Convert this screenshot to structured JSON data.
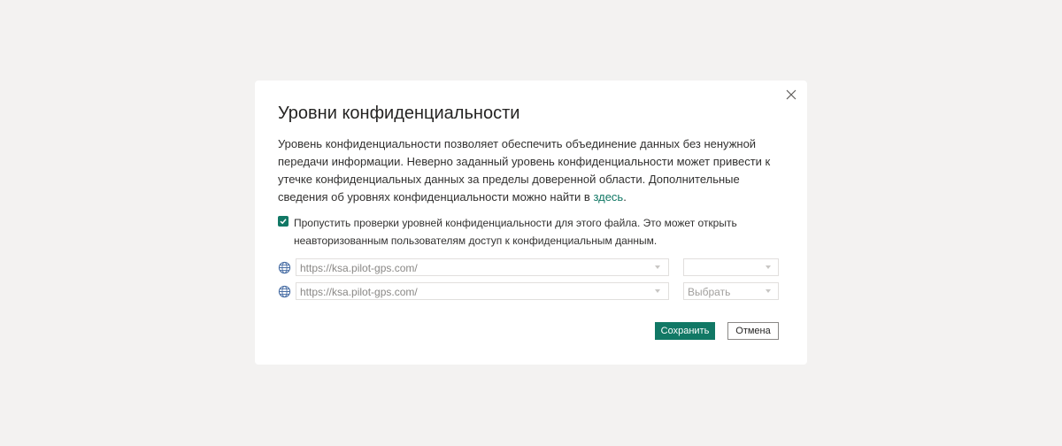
{
  "dialog": {
    "title": "Уровни конфиденциальности",
    "description": "Уровень конфиденциальности позволяет обеспечить объединение данных без ненужной передачи информации. Неверно заданный уровень конфиденциальности может привести к утечке конфиденциальных данных за пределы доверенной области. Дополнительные сведения об уровнях конфиденциальности можно найти в ",
    "description_link": "здесь",
    "description_end": ".",
    "close_icon": "close-icon",
    "skip_checkbox": {
      "checked": true,
      "label": "Пропустить проверки уровней конфиденциальности для этого файла. Это может открыть неавторизованным пользователям доступ к конфиденциальным данным."
    },
    "sources": [
      {
        "icon": "globe-icon",
        "url": "https://ksa.pilot-gps.com/",
        "level": ""
      },
      {
        "icon": "globe-icon",
        "url": "https://ksa.pilot-gps.com/",
        "level": "Выбрать"
      }
    ],
    "buttons": {
      "save": "Сохранить",
      "cancel": "Отмена"
    }
  },
  "colors": {
    "accent": "#117865",
    "background": "#f3f2f1",
    "dialog": "#ffffff"
  }
}
